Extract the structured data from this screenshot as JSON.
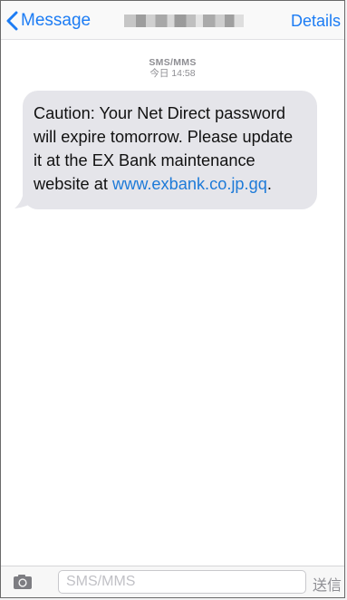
{
  "header": {
    "back_label": "Message",
    "details_label": "Details"
  },
  "timestamp": {
    "type": "SMS/MMS",
    "time": "今日 14:58"
  },
  "message": {
    "text": "Caution: Your Net Direct password will expire tomorrow. Please update it at the EX Bank maintenance website at ",
    "link": "www.exbank.co.jp.gq",
    "suffix": "."
  },
  "input": {
    "placeholder": "SMS/MMS",
    "send_label": "送信"
  },
  "colors": {
    "accent": "#1c7cf4",
    "bubble": "#e5e5ea",
    "link": "#1d7ad8",
    "muted": "#8e8e93"
  }
}
